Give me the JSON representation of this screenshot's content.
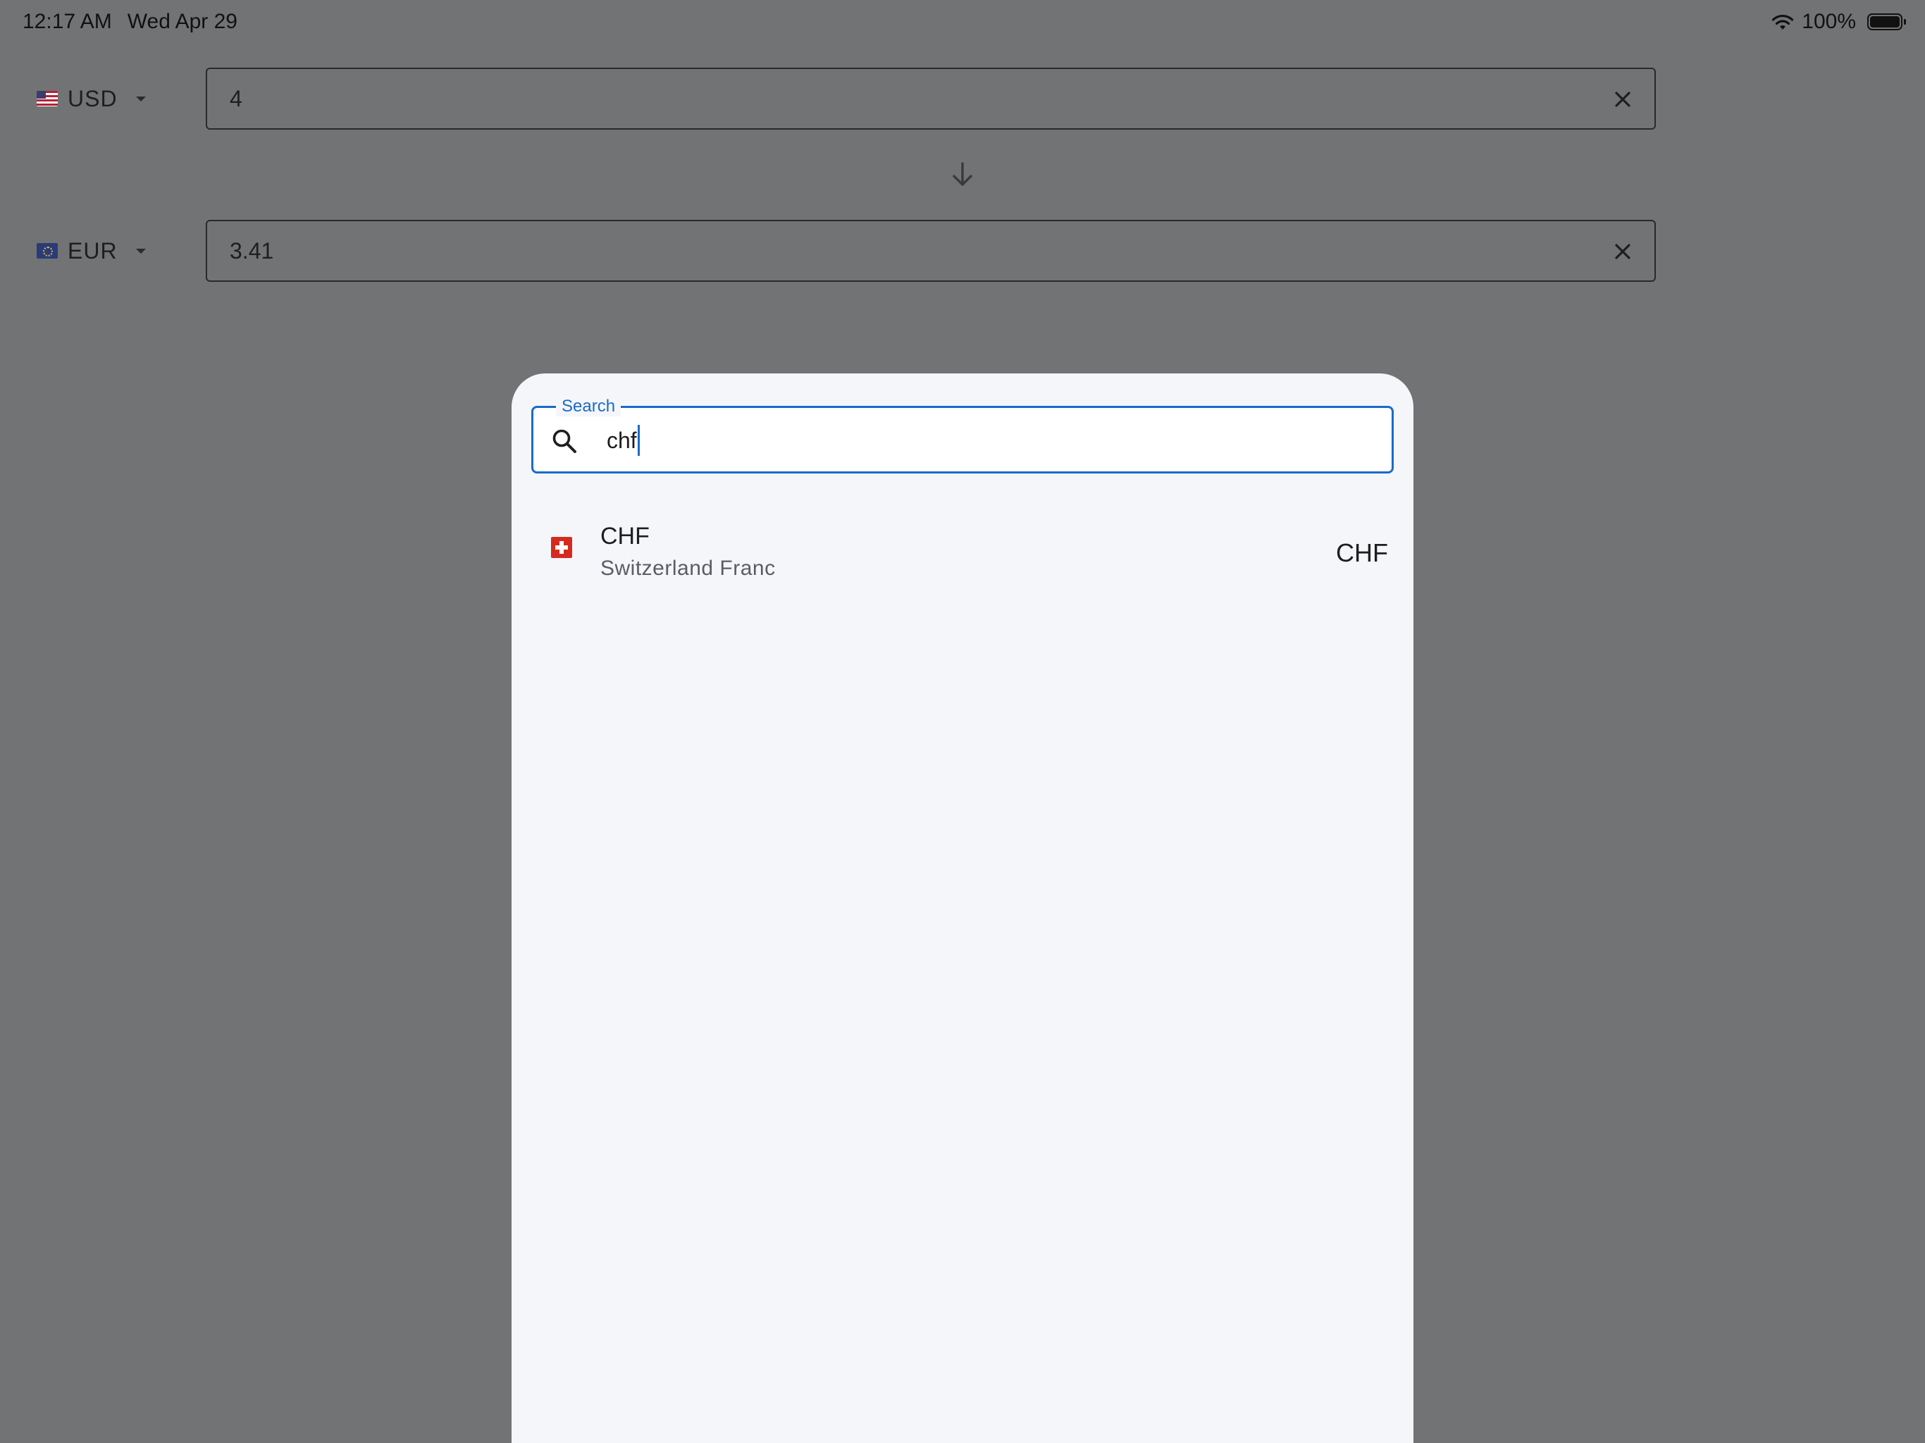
{
  "status_bar": {
    "time": "12:17 AM",
    "date": "Wed Apr 29",
    "battery_percent": "100%"
  },
  "converter": {
    "from": {
      "currency_code": "USD",
      "flag": "us-flag-icon",
      "amount": "4"
    },
    "to": {
      "currency_code": "EUR",
      "flag": "eu-flag-icon",
      "amount": "3.41"
    },
    "swap_icon": "arrow-down-icon"
  },
  "currency_picker": {
    "search": {
      "label": "Search",
      "value": "chf",
      "accent_color": "#1b6bc8"
    },
    "results": [
      {
        "code": "CHF",
        "name": "Switzerland Franc",
        "trailing_code": "CHF",
        "flag": "ch-flag-icon"
      }
    ]
  }
}
